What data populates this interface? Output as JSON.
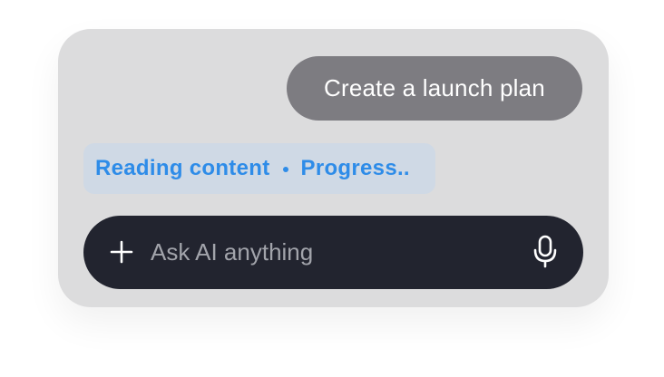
{
  "message": {
    "text": "Create a launch plan"
  },
  "status": {
    "step": "Reading content",
    "state": "Progress.."
  },
  "composer": {
    "placeholder": "Ask AI anything",
    "add_icon": "plus-icon",
    "voice_icon": "microphone-icon"
  },
  "colors": {
    "card_bg": "#dcdcdd",
    "bubble_bg": "#7d7c81",
    "status_bg": "#cfd9e5",
    "accent": "#2e8ce8",
    "composer_bg": "#22242f"
  }
}
